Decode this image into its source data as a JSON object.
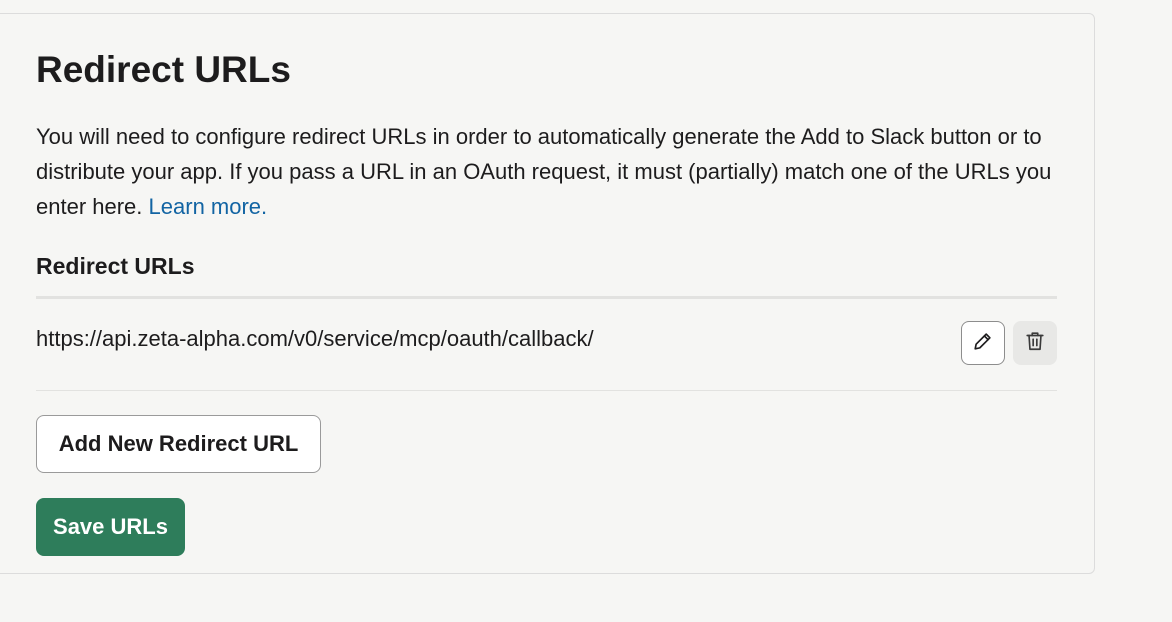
{
  "section": {
    "title": "Redirect URLs",
    "description": "You will need to configure redirect URLs in order to automatically generate the Add to Slack button or to distribute your app. If you pass a URL in an OAuth request, it must (partially) match one of the URLs you enter here.",
    "learn_more": "Learn more."
  },
  "urls": {
    "heading": "Redirect URLs",
    "items": [
      {
        "url": "https://api.zeta-alpha.com/v0/service/mcp/oauth/callback/"
      }
    ]
  },
  "actions": {
    "add_label": "Add New Redirect URL",
    "save_label": "Save URLs"
  },
  "icons": {
    "edit": "pencil-icon",
    "delete": "trash-icon"
  },
  "colors": {
    "link": "#1264a3",
    "save_button": "#2e7d5b",
    "background": "#f6f6f4"
  }
}
